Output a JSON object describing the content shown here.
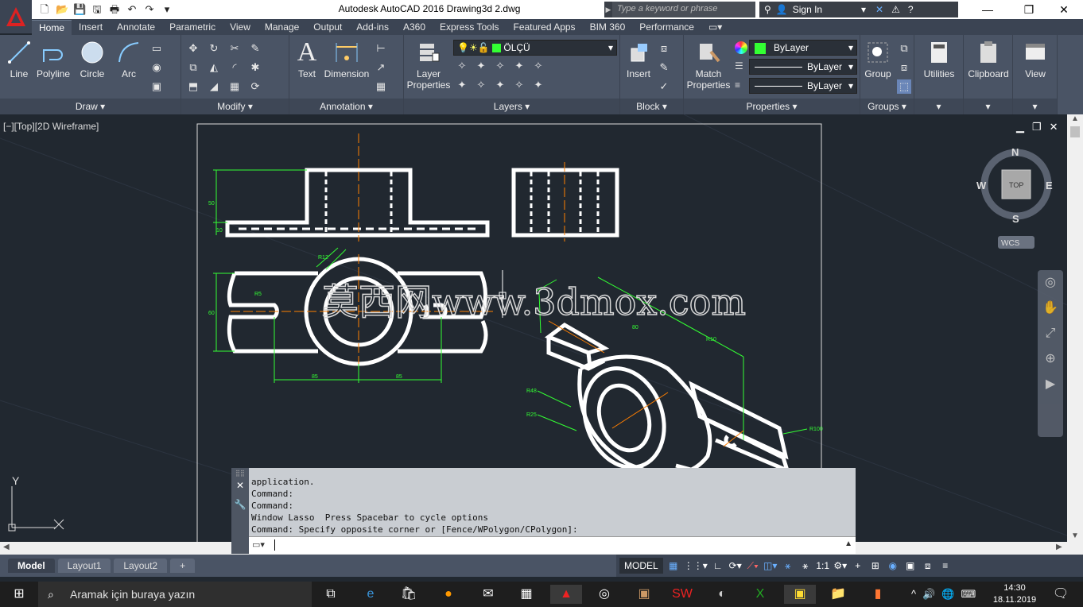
{
  "title_bar": {
    "title": "Autodesk AutoCAD 2016    Drawing3d 2.dwg",
    "search_placeholder": "Type a keyword or phrase",
    "signin_label": "Sign In"
  },
  "ribbon_tabs": [
    "Home",
    "Insert",
    "Annotate",
    "Parametric",
    "View",
    "Manage",
    "Output",
    "Add-ins",
    "A360",
    "Express Tools",
    "Featured Apps",
    "BIM 360",
    "Performance"
  ],
  "active_tab": "Home",
  "panels": {
    "draw": {
      "title": "Draw",
      "line": "Line",
      "polyline": "Polyline",
      "circle": "Circle",
      "arc": "Arc"
    },
    "modify": {
      "title": "Modify"
    },
    "annotation": {
      "title": "Annotation",
      "text": "Text",
      "dimension": "Dimension"
    },
    "layers": {
      "title": "Layers",
      "layer_properties_1": "Layer",
      "layer_properties_2": "Properties",
      "current_layer": "ÖLÇÜ"
    },
    "block": {
      "title": "Block",
      "insert": "Insert"
    },
    "properties": {
      "title": "Properties",
      "match_1": "Match",
      "match_2": "Properties",
      "color": "ByLayer",
      "linetype": "ByLayer",
      "lineweight": "ByLayer"
    },
    "groups": {
      "title": "Groups",
      "group": "Group"
    },
    "utilities": {
      "label": "Utilities"
    },
    "clipboard": {
      "label": "Clipboard"
    },
    "view": {
      "label": "View"
    }
  },
  "viewport": {
    "label": "[−][Top][2D Wireframe]",
    "viewcube_top": "TOP",
    "compass_n": "N",
    "compass_s": "S",
    "compass_e": "E",
    "compass_w": "W",
    "wcs": "WCS",
    "watermark": "莫西网www.3dmox.com",
    "ucs_y": "Y"
  },
  "dimensions": {
    "d50": "50",
    "d10": "10",
    "d60": "60",
    "d85a": "85",
    "d85b": "85",
    "r48": "R48",
    "r25": "R25",
    "r100": "R100",
    "r5": "R5",
    "r12": "R12",
    "r10": "R10",
    "d80": "80"
  },
  "command_history": [
    "application.",
    "Command:",
    "Command:",
    "Window Lasso  Press Spacebar to cycle options",
    "Command: Specify opposite corner or [Fence/WPolygon/CPolygon]:"
  ],
  "layout_tabs": [
    "Model",
    "Layout1",
    "Layout2"
  ],
  "status": {
    "model": "MODEL",
    "scale": "1:1"
  },
  "taskbar": {
    "search_placeholder": "Aramak için buraya yazın",
    "time": "14:30",
    "date": "18.11.2019"
  },
  "colors": {
    "accent": "#3b4453",
    "ribbon": "#4a5465",
    "drawing_bg": "#212830",
    "dim_green": "#33ff33",
    "center_orange": "#ff7f00",
    "bylayer_green": "#33ff33"
  }
}
